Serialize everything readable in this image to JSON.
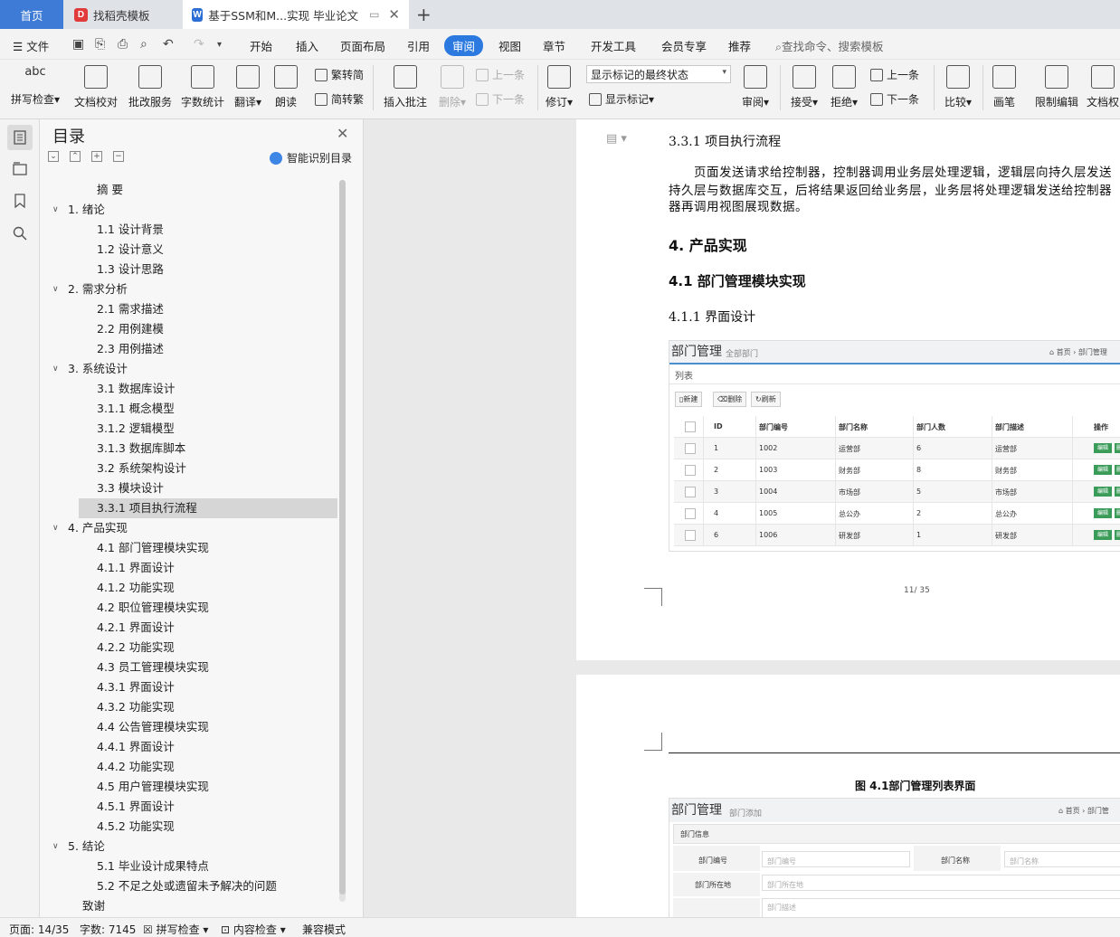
{
  "tabs": [
    {
      "label": "首页",
      "icon": "home"
    },
    {
      "label": "找稻壳模板",
      "icon": "docer-icon"
    },
    {
      "label": "基于SSM和M...实现 毕业论文",
      "icon": "wps-writer-icon"
    }
  ],
  "menu": {
    "file": "文件",
    "items": [
      "开始",
      "插入",
      "页面布局",
      "引用",
      "审阅",
      "视图",
      "章节",
      "开发工具",
      "会员专享",
      "推荐"
    ],
    "active": "审阅",
    "search_placeholder": "查找命令、搜索模板"
  },
  "ribbon": {
    "spellcheck": "拼写检查",
    "proofread": "文档校对",
    "batch": "批改服务",
    "wordcount": "字数统计",
    "translate": "翻译",
    "read": "朗读",
    "to_traditional": "繁转简",
    "to_simplified": "简转繁",
    "insert_comment": "插入批注",
    "delete": "删除",
    "prev_comment": "上一条",
    "next_comment": "下一条",
    "track": "修订",
    "markup_state": "显示标记的最终状态",
    "show_markup": "显示标记",
    "review": "审阅",
    "accept": "接受",
    "reject": "拒绝",
    "prev": "上一条",
    "next": "下一条",
    "compare": "比较",
    "pen": "画笔",
    "restrict": "限制编辑",
    "doc_rights": "文档权"
  },
  "toc": {
    "title": "目录",
    "smart": "智能识别目录",
    "items": [
      {
        "label": "摘 要",
        "level": 1,
        "arrow": false
      },
      {
        "label": "1.   绪论",
        "level": 0,
        "arrow": true
      },
      {
        "label": "1.1 设计背景",
        "level": 1,
        "arrow": false
      },
      {
        "label": "1.2 设计意义",
        "level": 1,
        "arrow": false
      },
      {
        "label": "1.3 设计思路",
        "level": 1,
        "arrow": false
      },
      {
        "label": "2. 需求分析",
        "level": 0,
        "arrow": true
      },
      {
        "label": "2.1 需求描述",
        "level": 1,
        "arrow": false
      },
      {
        "label": "2.2 用例建模",
        "level": 1,
        "arrow": false
      },
      {
        "label": "2.3 用例描述",
        "level": 1,
        "arrow": false
      },
      {
        "label": "3. 系统设计",
        "level": 0,
        "arrow": true
      },
      {
        "label": "3.1 数据库设计",
        "level": 1,
        "arrow": false
      },
      {
        "label": "3.1.1 概念模型",
        "level": 1,
        "arrow": false
      },
      {
        "label": "3.1.2 逻辑模型",
        "level": 1,
        "arrow": false
      },
      {
        "label": "3.1.3 数据库脚本",
        "level": 1,
        "arrow": false
      },
      {
        "label": "3.2 系统架构设计",
        "level": 1,
        "arrow": false
      },
      {
        "label": "3.3 模块设计",
        "level": 1,
        "arrow": false
      },
      {
        "label": "3.3.1 项目执行流程",
        "level": 1,
        "arrow": false,
        "selected": true
      },
      {
        "label": "4. 产品实现",
        "level": 0,
        "arrow": true
      },
      {
        "label": "4.1 部门管理模块实现",
        "level": 1,
        "arrow": false
      },
      {
        "label": "4.1.1 界面设计",
        "level": 1,
        "arrow": false
      },
      {
        "label": "4.1.2 功能实现",
        "level": 1,
        "arrow": false
      },
      {
        "label": "4.2 职位管理模块实现",
        "level": 1,
        "arrow": false
      },
      {
        "label": "4.2.1 界面设计",
        "level": 1,
        "arrow": false
      },
      {
        "label": "4.2.2 功能实现",
        "level": 1,
        "arrow": false
      },
      {
        "label": "4.3 员工管理模块实现",
        "level": 1,
        "arrow": false
      },
      {
        "label": "4.3.1 界面设计",
        "level": 1,
        "arrow": false
      },
      {
        "label": "4.3.2 功能实现",
        "level": 1,
        "arrow": false
      },
      {
        "label": "4.4 公告管理模块实现",
        "level": 1,
        "arrow": false
      },
      {
        "label": "4.4.1 界面设计",
        "level": 1,
        "arrow": false
      },
      {
        "label": "4.4.2 功能实现",
        "level": 1,
        "arrow": false
      },
      {
        "label": "4.5 用户管理模块实现",
        "level": 1,
        "arrow": false
      },
      {
        "label": "4.5.1 界面设计",
        "level": 1,
        "arrow": false
      },
      {
        "label": "4.5.2 功能实现",
        "level": 1,
        "arrow": false
      },
      {
        "label": "5. 结论",
        "level": 0,
        "arrow": true
      },
      {
        "label": "5.1 毕业设计成果特点",
        "level": 1,
        "arrow": false
      },
      {
        "label": "5.2 不足之处或遗留未予解决的问题",
        "level": 1,
        "arrow": false
      },
      {
        "label": "致谢",
        "level": 0,
        "arrow": false
      }
    ]
  },
  "doc": {
    "h_331": "3.3.1 项目执行流程",
    "para1": "页面发送请求给控制器，控制器调用业务层处理逻辑，逻辑层向持久层发送",
    "para2": "持久层与数据库交互，后将结果返回给业务层，业务层将处理逻辑发送给控制器",
    "para3": "器再调用视图展现数据。",
    "h_4": "4. 产品实现",
    "h_41": "4.1 部门管理模块实现",
    "h_411": "4.1.1 界面设计",
    "page_num": "11/ 35",
    "fig_caption": "图 4.1部门管理列表界面"
  },
  "shot1": {
    "title": "部门管理",
    "subtitle": "全部部门",
    "breadcrumb": "首页 › 部门管理",
    "list_label": "列表",
    "btn_new": "新建",
    "btn_delete": "删除",
    "btn_refresh": "刷新",
    "headers": [
      "ID",
      "部门编号",
      "部门名称",
      "部门人数",
      "部门描述",
      "操作"
    ],
    "rows": [
      [
        "1",
        "1002",
        "运营部",
        "6",
        "运营部"
      ],
      [
        "2",
        "1003",
        "财务部",
        "8",
        "财务部"
      ],
      [
        "3",
        "1004",
        "市场部",
        "5",
        "市场部"
      ],
      [
        "4",
        "1005",
        "总公办",
        "2",
        "总公办"
      ],
      [
        "6",
        "1006",
        "研发部",
        "1",
        "研发部"
      ]
    ],
    "edit_label": "编辑",
    "delete_label": "删"
  },
  "shot2": {
    "title": "部门管理",
    "subtitle": "部门添加",
    "breadcrumb": "首页 › 部门管",
    "section": "部门信息",
    "f_code": "部门编号",
    "f_code_ph": "部门编号",
    "f_name": "部门名称",
    "f_name_ph": "部门名称",
    "f_loc": "部门所在地",
    "f_loc_ph": "部门所在地",
    "f_desc_ph": "部门描述"
  },
  "status": {
    "page": "页面: 14/35",
    "words": "字数: 7145",
    "spell": "拼写检查",
    "content": "内容检查",
    "compat": "兼容模式"
  },
  "colors": {
    "accent": "#2c7ae0",
    "home_tab": "#3d7bd6",
    "edit_green": "#3b9c5a"
  }
}
